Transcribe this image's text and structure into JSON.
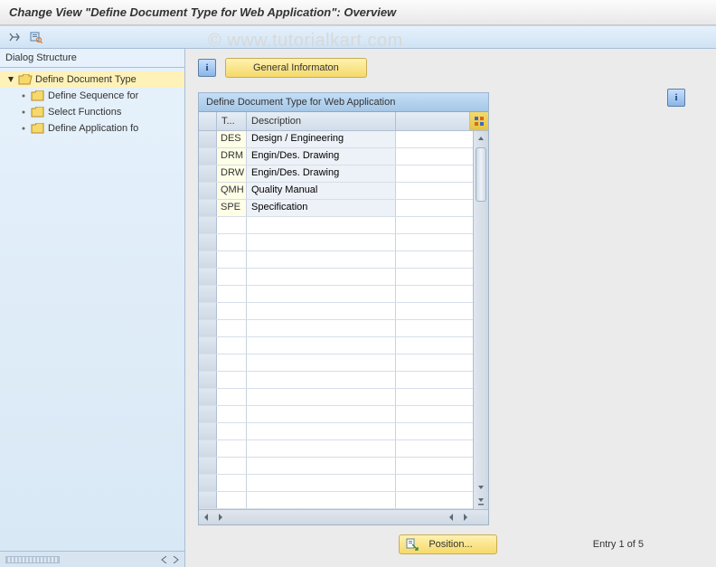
{
  "title": "Change View \"Define Document Type for Web Application\": Overview",
  "watermark": "© www.tutorialkart.com",
  "sidebar": {
    "header": "Dialog Structure",
    "items": [
      {
        "label": "Define Document Type",
        "selected": true,
        "open": true,
        "openFolder": true,
        "hasArrow": true
      },
      {
        "label": "Define Sequence for"
      },
      {
        "label": "Select Functions"
      },
      {
        "label": "Define Application fo"
      }
    ]
  },
  "generalInfoLabel": "General Informaton",
  "table": {
    "title": "Define Document Type for Web Application",
    "headers": {
      "code": "T...",
      "desc": "Description"
    },
    "rows": [
      {
        "code": "DES",
        "desc": "Design / Engineering"
      },
      {
        "code": "DRM",
        "desc": "Engin/Des. Drawing"
      },
      {
        "code": "DRW",
        "desc": "Engin/Des. Drawing"
      },
      {
        "code": "QMH",
        "desc": "Quality Manual"
      },
      {
        "code": "SPE",
        "desc": "Specification"
      }
    ],
    "emptyRows": 17
  },
  "positionLabel": "Position...",
  "entryText": "Entry 1 of 5"
}
